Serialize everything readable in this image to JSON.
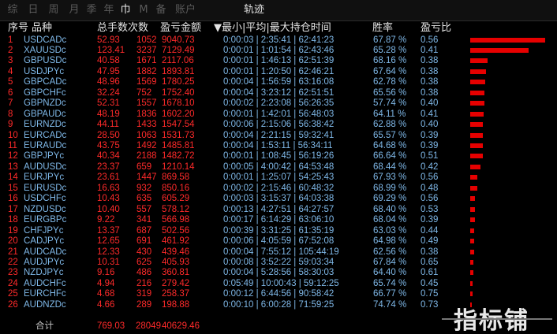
{
  "tabs": [
    {
      "label": "综",
      "active": false
    },
    {
      "label": "日",
      "active": false
    },
    {
      "label": "周",
      "active": false
    },
    {
      "label": "月",
      "active": false
    },
    {
      "label": "季",
      "active": false
    },
    {
      "label": "年",
      "active": false
    },
    {
      "label": "巾",
      "active": true
    },
    {
      "label": "M",
      "active": false
    },
    {
      "label": "备",
      "active": false
    },
    {
      "label": "账户",
      "active": false
    },
    {
      "label": "轨迹",
      "active": true
    }
  ],
  "headers": {
    "index": "序号",
    "symbol": "品种",
    "total_pips": "总手数",
    "count": "次数",
    "profit": "盈亏金额",
    "time": "▼最小|平均|最大持仓时间",
    "winrate": "胜率",
    "pl_ratio": "盈亏比"
  },
  "rows": [
    {
      "idx": "1",
      "sym": "USDCADc",
      "pips": "52.93",
      "count": "1052",
      "profit": "9040.73",
      "time": "0:00:03 | 2:35:41 | 62:41:23",
      "win": "67.87 %",
      "ratio": "0.56",
      "bar": 1.0
    },
    {
      "idx": "2",
      "sym": "XAUUSDc",
      "pips": "123.41",
      "count": "3237",
      "profit": "7129.49",
      "time": "0:00:01 | 1:01:54 | 62:43:46",
      "win": "65.28 %",
      "ratio": "0.41",
      "bar": 0.78
    },
    {
      "idx": "3",
      "sym": "GBPUSDc",
      "pips": "40.58",
      "count": "1671",
      "profit": "2117.06",
      "time": "0:00:01 | 1:46:13 | 62:51:39",
      "win": "68.16 %",
      "ratio": "0.38",
      "bar": 0.234
    },
    {
      "idx": "4",
      "sym": "USDJPYc",
      "pips": "47.95",
      "count": "1882",
      "profit": "1893.81",
      "time": "0:00:01 | 1:20:50 | 62:46:21",
      "win": "67.64 %",
      "ratio": "0.38",
      "bar": 0.209
    },
    {
      "idx": "5",
      "sym": "GBPCADc",
      "pips": "48.96",
      "count": "1569",
      "profit": "1780.25",
      "time": "0:00:04 | 1:56:59 | 63:16:08",
      "win": "62.78 %",
      "ratio": "0.38",
      "bar": 0.197
    },
    {
      "idx": "6",
      "sym": "GBPCHFc",
      "pips": "32.24",
      "count": "752",
      "profit": "1752.40",
      "time": "0:00:04 | 3:23:12 | 62:51:51",
      "win": "65.56 %",
      "ratio": "0.38",
      "bar": 0.194
    },
    {
      "idx": "7",
      "sym": "GBPNZDc",
      "pips": "52.31",
      "count": "1557",
      "profit": "1678.10",
      "time": "0:00:02 | 2:23:08 | 56:26:35",
      "win": "57.74 %",
      "ratio": "0.40",
      "bar": 0.186
    },
    {
      "idx": "8",
      "sym": "GBPAUDc",
      "pips": "48.19",
      "count": "1836",
      "profit": "1602.20",
      "time": "0:00:01 | 1:42:01 | 56:48:03",
      "win": "64.11 %",
      "ratio": "0.41",
      "bar": 0.177
    },
    {
      "idx": "9",
      "sym": "EURNZDc",
      "pips": "44.11",
      "count": "1433",
      "profit": "1547.54",
      "time": "0:00:06 | 2:15:06 | 56:38:42",
      "win": "62.88 %",
      "ratio": "0.40",
      "bar": 0.171
    },
    {
      "idx": "10",
      "sym": "EURCADc",
      "pips": "28.50",
      "count": "1063",
      "profit": "1531.73",
      "time": "0:00:04 | 2:21:15 | 59:32:41",
      "win": "65.57 %",
      "ratio": "0.39",
      "bar": 0.169
    },
    {
      "idx": "11",
      "sym": "EURAUDc",
      "pips": "43.75",
      "count": "1492",
      "profit": "1485.81",
      "time": "0:00:04 | 1:53:11 | 56:34:11",
      "win": "64.68 %",
      "ratio": "0.39",
      "bar": 0.164
    },
    {
      "idx": "12",
      "sym": "GBPJPYc",
      "pips": "40.34",
      "count": "2188",
      "profit": "1482.72",
      "time": "0:00:01 | 1:08:45 | 56:19:26",
      "win": "66.64 %",
      "ratio": "0.51",
      "bar": 0.164
    },
    {
      "idx": "13",
      "sym": "AUDUSDc",
      "pips": "23.37",
      "count": "659",
      "profit": "1210.14",
      "time": "0:00:05 | 4:00:42 | 64:53:48",
      "win": "68.44 %",
      "ratio": "0.42",
      "bar": 0.134
    },
    {
      "idx": "14",
      "sym": "EURJPYc",
      "pips": "23.61",
      "count": "1447",
      "profit": "869.58",
      "time": "0:00:01 | 1:25:07 | 54:25:43",
      "win": "67.93 %",
      "ratio": "0.56",
      "bar": 0.096
    },
    {
      "idx": "15",
      "sym": "EURUSDc",
      "pips": "16.63",
      "count": "932",
      "profit": "850.16",
      "time": "0:00:02 | 2:15:46 | 60:48:32",
      "win": "68.99 %",
      "ratio": "0.48",
      "bar": 0.094
    },
    {
      "idx": "16",
      "sym": "USDCHFc",
      "pips": "10.43",
      "count": "635",
      "profit": "605.29",
      "time": "0:00:03 | 3:15:37 | 64:03:38",
      "win": "69.29 %",
      "ratio": "0.56",
      "bar": 0.067
    },
    {
      "idx": "17",
      "sym": "NZDUSDc",
      "pips": "10.40",
      "count": "557",
      "profit": "578.12",
      "time": "0:00:13 | 4:27:51 | 64:27:57",
      "win": "68.40 %",
      "ratio": "0.53",
      "bar": 0.064
    },
    {
      "idx": "18",
      "sym": "EURGBPc",
      "pips": "9.22",
      "count": "341",
      "profit": "566.98",
      "time": "0:00:17 | 6:14:29 | 63:06:10",
      "win": "68.04 %",
      "ratio": "0.39",
      "bar": 0.063
    },
    {
      "idx": "19",
      "sym": "CHFJPYc",
      "pips": "13.37",
      "count": "687",
      "profit": "502.56",
      "time": "0:00:39 | 3:31:25 | 61:35:19",
      "win": "63.03 %",
      "ratio": "0.44",
      "bar": 0.056
    },
    {
      "idx": "20",
      "sym": "CADJPYc",
      "pips": "12.65",
      "count": "691",
      "profit": "461.92",
      "time": "0:00:06 | 4:05:59 | 67:52:08",
      "win": "64.98 %",
      "ratio": "0.49",
      "bar": 0.051
    },
    {
      "idx": "21",
      "sym": "AUDCADc",
      "pips": "12.33",
      "count": "430",
      "profit": "439.46",
      "time": "0:00:04 | 7:55:12 | 105:44:19",
      "win": "62.56 %",
      "ratio": "0.38",
      "bar": 0.049
    },
    {
      "idx": "22",
      "sym": "AUDJPYc",
      "pips": "10.31",
      "count": "625",
      "profit": "405.93",
      "time": "0:00:08 | 3:52:22 | 59:03:34",
      "win": "67.84 %",
      "ratio": "0.65",
      "bar": 0.045
    },
    {
      "idx": "23",
      "sym": "NZDJPYc",
      "pips": "9.16",
      "count": "486",
      "profit": "360.81",
      "time": "0:00:04 | 5:28:56 | 58:30:03",
      "win": "64.40 %",
      "ratio": "0.61",
      "bar": 0.04
    },
    {
      "idx": "24",
      "sym": "AUDCHFc",
      "pips": "4.94",
      "count": "216",
      "profit": "279.42",
      "time": "0:05:49 | 10:00:43 | 59:12:25",
      "win": "65.74 %",
      "ratio": "0.45",
      "bar": 0.031
    },
    {
      "idx": "25",
      "sym": "EURCHFc",
      "pips": "4.68",
      "count": "319",
      "profit": "258.37",
      "time": "0:00:12 | 6:44:56 | 90:58:42",
      "win": "66.77 %",
      "ratio": "0.75",
      "bar": 0.029
    },
    {
      "idx": "26",
      "sym": "AUDNZDc",
      "pips": "4.66",
      "count": "289",
      "profit": "198.88",
      "time": "0:00:10 | 6:00:28 | 71:59:25",
      "win": "74.74 %",
      "ratio": "0.73",
      "bar": 0.022
    }
  ],
  "total": {
    "label": "合计",
    "pips": "769.03",
    "count": "28049",
    "profit": "40629.46"
  },
  "watermark": "指标铺",
  "colors": {
    "up": "#ff2a2a",
    "symbol": "#7fb8e8",
    "bar": "#e60000",
    "bg": "#000000"
  }
}
